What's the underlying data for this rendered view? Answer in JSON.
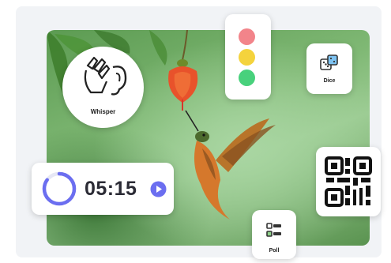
{
  "widgets": {
    "whisper": {
      "label": "Whisper",
      "icon": "whisper-ear-icon"
    },
    "traffic_light": {
      "icon": "traffic-light-icon",
      "colors": [
        "#f2848a",
        "#f4d33d",
        "#48d17c"
      ]
    },
    "dice": {
      "label": "Dice",
      "icon": "dice-icon"
    },
    "qr": {
      "icon": "qr-code-icon"
    },
    "poll": {
      "label": "Poll",
      "icon": "poll-icon"
    },
    "timer": {
      "time": "05:15",
      "progress": 0.85,
      "accent": "#6b6ef0",
      "icon": "play-icon"
    }
  },
  "background": {
    "subject": "hummingbird-image"
  }
}
